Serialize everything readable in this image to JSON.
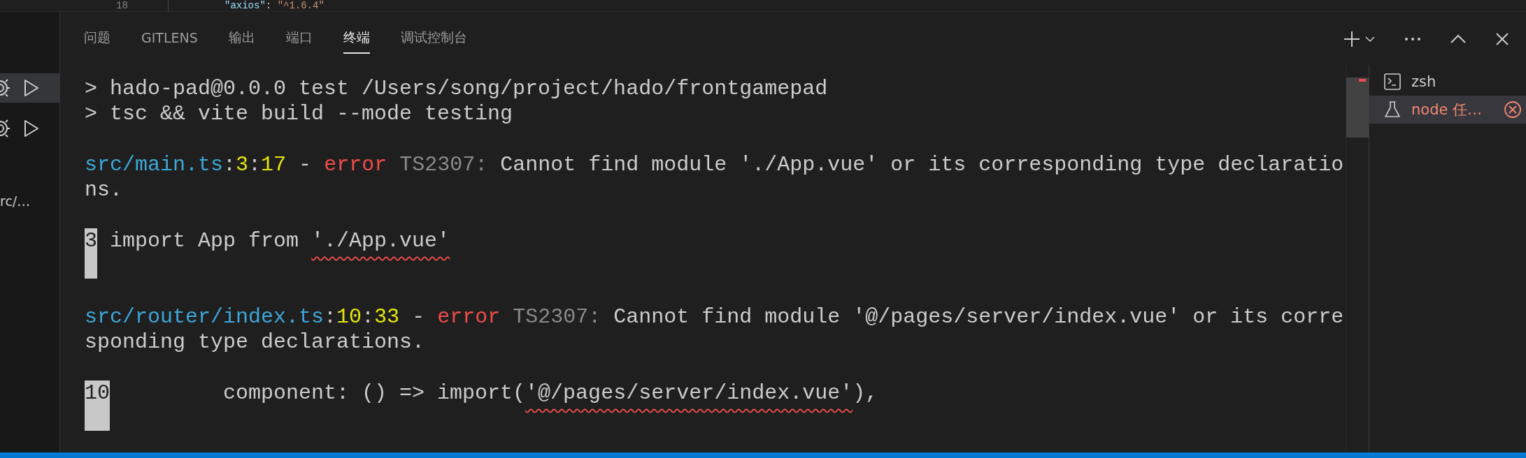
{
  "editor": {
    "line_number": "18",
    "code": [
      {
        "text": "\"axios\"",
        "kind": "key"
      },
      {
        "text": ": ",
        "kind": "plain"
      },
      {
        "text": "\"^1.6.4\"",
        "kind": "string"
      }
    ]
  },
  "sidebar": {
    "rows": [
      {
        "selected": true
      },
      {
        "selected": false
      }
    ],
    "path_text": "rc/…"
  },
  "panel_tabs": [
    {
      "label": "问题",
      "selected": false
    },
    {
      "label": "GITLENS",
      "selected": false
    },
    {
      "label": "输出",
      "selected": false
    },
    {
      "label": "端口",
      "selected": false
    },
    {
      "label": "终端",
      "selected": true
    },
    {
      "label": "调试控制台",
      "selected": false
    }
  ],
  "terminal": {
    "command_lines": [
      "> hado-pad@0.0.0 test /Users/song/project/hado/frontgamepad",
      "> tsc && vite build --mode testing"
    ],
    "diagnostics": [
      {
        "header": [
          {
            "text": "src/main.ts",
            "kind": "path"
          },
          {
            "text": ":",
            "kind": "plain"
          },
          {
            "text": "3",
            "kind": "number"
          },
          {
            "text": ":",
            "kind": "plain"
          },
          {
            "text": "17",
            "kind": "number"
          },
          {
            "text": " - ",
            "kind": "plain"
          },
          {
            "text": "error",
            "kind": "error"
          },
          {
            "text": " TS2307:",
            "kind": "code"
          },
          {
            "text": " Cannot find module './App.vue' or its corresponding type declaratio",
            "kind": "plain"
          }
        ],
        "continuation": "ns.",
        "snippet": {
          "gutter": "3",
          "code": [
            {
              "text": "import App from ",
              "squiggle": false
            },
            {
              "text": "'./App.vue'",
              "squiggle": true
            }
          ]
        }
      },
      {
        "header": [
          {
            "text": "src/router/index.ts",
            "kind": "path"
          },
          {
            "text": ":",
            "kind": "plain"
          },
          {
            "text": "10",
            "kind": "number"
          },
          {
            "text": ":",
            "kind": "plain"
          },
          {
            "text": "33",
            "kind": "number"
          },
          {
            "text": " - ",
            "kind": "plain"
          },
          {
            "text": "error",
            "kind": "error"
          },
          {
            "text": " TS2307:",
            "kind": "code"
          },
          {
            "text": " Cannot find module '@/pages/server/index.vue' or its corre",
            "kind": "plain"
          }
        ],
        "continuation": "sponding type declarations.",
        "snippet": {
          "gutter": "10",
          "code": [
            {
              "text": "        component: () => import(",
              "squiggle": false
            },
            {
              "text": "'@/pages/server/index.vue'",
              "squiggle": true
            },
            {
              "text": "),",
              "squiggle": false
            }
          ]
        }
      }
    ]
  },
  "terminal_list": [
    {
      "label": "zsh",
      "kind": "shell",
      "selected": false,
      "error": false
    },
    {
      "label": "node 任…",
      "kind": "task",
      "selected": true,
      "error": true
    }
  ]
}
